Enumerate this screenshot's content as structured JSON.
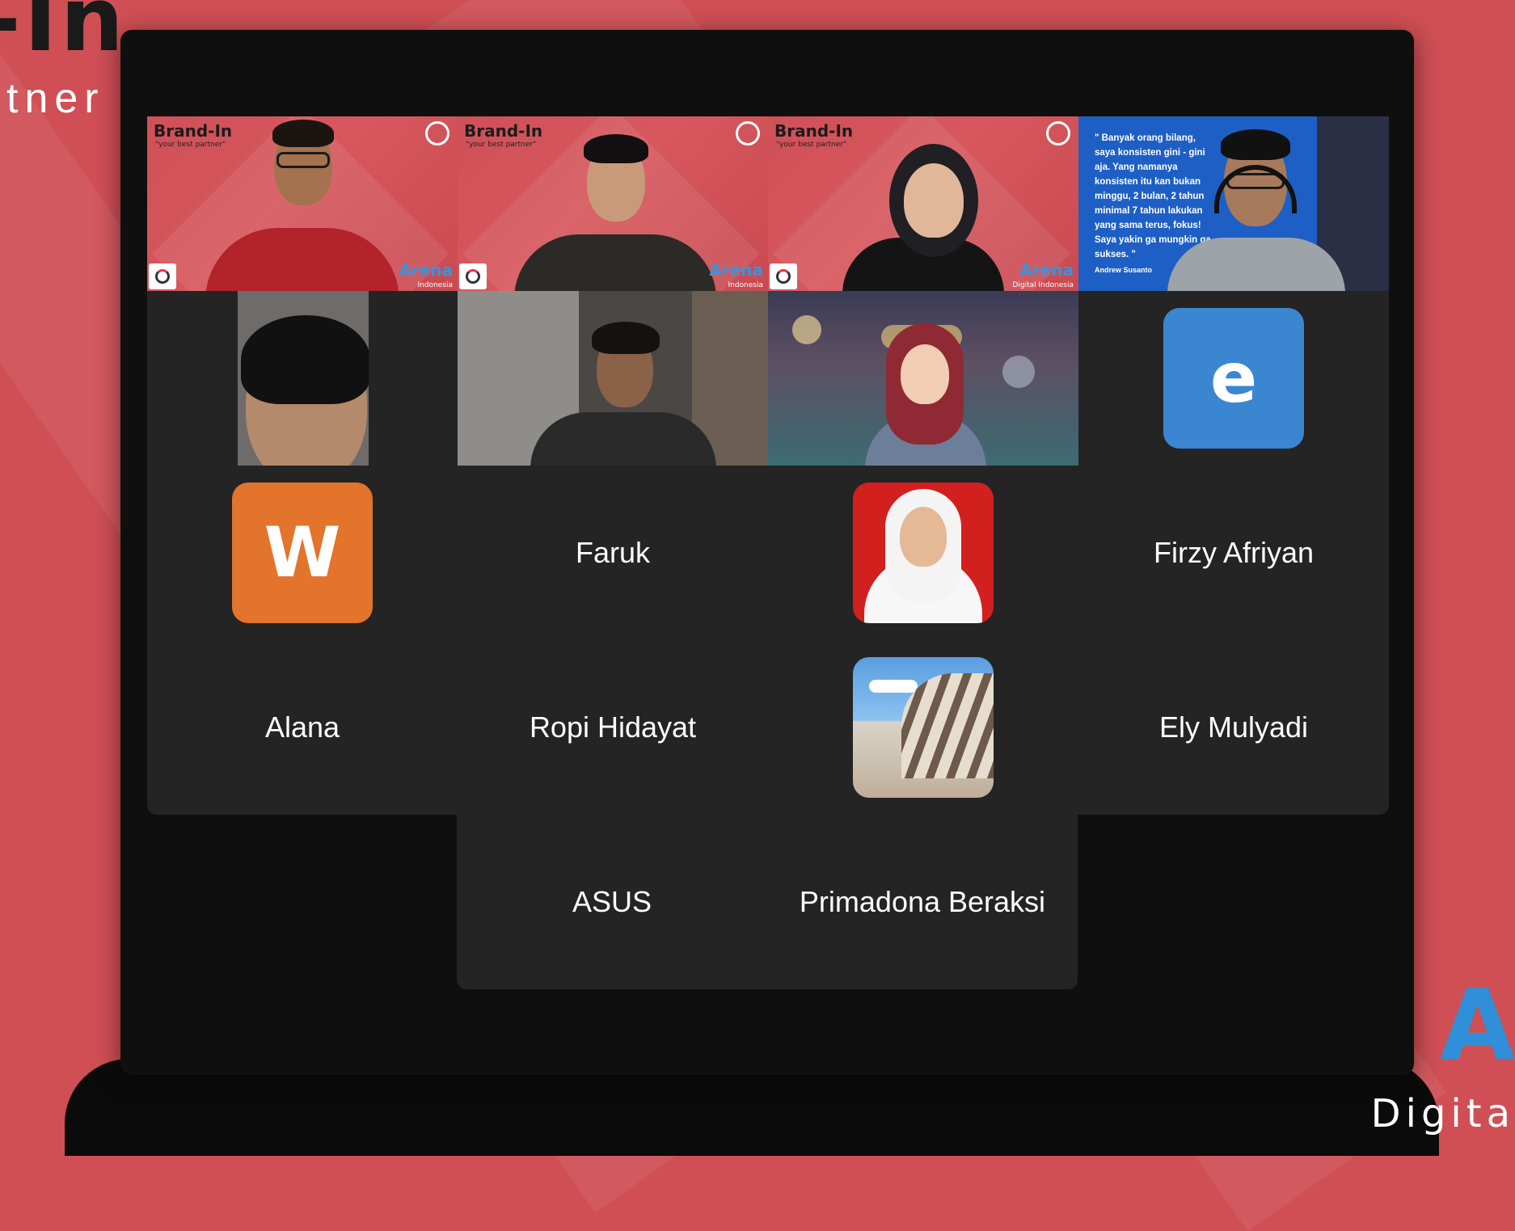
{
  "background": {
    "logo_text": "-In",
    "subtitle_text": "tner",
    "brand_text": "A",
    "brand_sub_text": "Digita"
  },
  "tiles": {
    "t1": {
      "brand_title": "Brand-In",
      "brand_tag": "\"your best partner\"",
      "arena": "Arena",
      "arena_sub": "Indonesia"
    },
    "t2": {
      "brand_title": "Brand-In",
      "brand_tag": "\"your best partner\"",
      "arena": "Arena",
      "arena_sub": "Indonesia"
    },
    "t3": {
      "brand_title": "Brand-In",
      "brand_tag": "\"your best partner\"",
      "arena": "Arena",
      "arena_sub": "Digital Indonesia"
    },
    "t4": {
      "quote": "\" Banyak orang bilang, saya konsisten gini - gini aja. Yang namanya konsisten itu kan bukan minggu, 2 bulan, 2 tahun minimal 7 tahun lakukan yang sama terus, fokus! Saya yakin ga mungkin ga sukses. \"",
      "author": "Andrew Susanto"
    },
    "t8": {
      "avatar_letter": "e"
    },
    "t9": {
      "avatar_letter": "W"
    },
    "t10": {
      "name": "Faruk"
    },
    "t12": {
      "name": "Firzy Afriyan"
    },
    "t13": {
      "name": "Alana"
    },
    "t14": {
      "name": "Ropi Hidayat"
    },
    "t16": {
      "name": "Ely Mulyadi"
    },
    "t17": {
      "name": "ASUS"
    },
    "t18": {
      "name": "Primadona Beraksi"
    }
  },
  "colors": {
    "active_speaker_border": "#4ccd4c",
    "avatar_e": "#3b86d0",
    "avatar_w": "#e2742c"
  }
}
